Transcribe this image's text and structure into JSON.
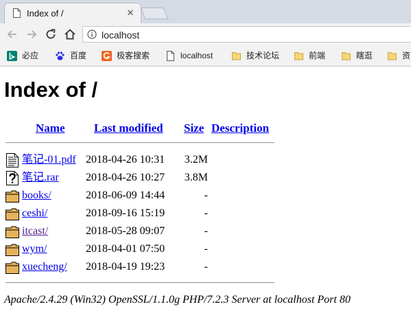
{
  "browser": {
    "tab": {
      "title": "Index of /",
      "close_glyph": "✕"
    },
    "address_bar": {
      "url": "localhost"
    },
    "bookmarks": [
      {
        "label": "必应",
        "icon": "bing-icon",
        "color": "#008373"
      },
      {
        "label": "百度",
        "icon": "baidu-paw-icon",
        "color": "#2932e1"
      },
      {
        "label": "极客搜索",
        "icon": "geek-search-g-icon",
        "color": "#f26522"
      },
      {
        "label": "localhost",
        "icon": "page-icon",
        "color": "#666666"
      },
      {
        "label": "技术论坛",
        "icon": "folder-icon",
        "color": "#f6d77a"
      },
      {
        "label": "前端",
        "icon": "folder-icon",
        "color": "#f6d77a"
      },
      {
        "label": "瞎逛",
        "icon": "folder-icon",
        "color": "#f6d77a"
      },
      {
        "label": "资",
        "icon": "folder-icon",
        "color": "#f6d77a"
      }
    ]
  },
  "page": {
    "heading": "Index of /",
    "columns": {
      "name": "Name",
      "last_modified": "Last modified",
      "size": "Size",
      "description": "Description"
    },
    "entries": [
      {
        "name": "笔记-01.pdf",
        "modified": "2018-04-26 10:31",
        "size": "3.2M",
        "icon": "document-file-icon",
        "visited": false
      },
      {
        "name": "笔记.rar",
        "modified": "2018-04-26 10:27",
        "size": "3.8M",
        "icon": "unknown-file-icon",
        "visited": false
      },
      {
        "name": "books/",
        "modified": "2018-06-09 14:44",
        "size": "-",
        "icon": "folder-icon",
        "visited": false
      },
      {
        "name": "ceshi/",
        "modified": "2018-09-16 15:19",
        "size": "-",
        "icon": "folder-icon",
        "visited": false
      },
      {
        "name": "itcast/",
        "modified": "2018-05-28 09:07",
        "size": "-",
        "icon": "folder-icon",
        "visited": true
      },
      {
        "name": "wym/",
        "modified": "2018-04-01 07:50",
        "size": "-",
        "icon": "folder-icon",
        "visited": false
      },
      {
        "name": "xuecheng/",
        "modified": "2018-04-19 19:23",
        "size": "-",
        "icon": "folder-icon",
        "visited": false
      }
    ],
    "server_signature": "Apache/2.4.29 (Win32) OpenSSL/1.1.0g PHP/7.2.3 Server at localhost Port 80"
  },
  "colors": {
    "link": "#0000ee",
    "visited_link": "#551a8b",
    "chrome_bg": "#f2f2f2",
    "tabstrip_bg": "#d5dbe4"
  }
}
